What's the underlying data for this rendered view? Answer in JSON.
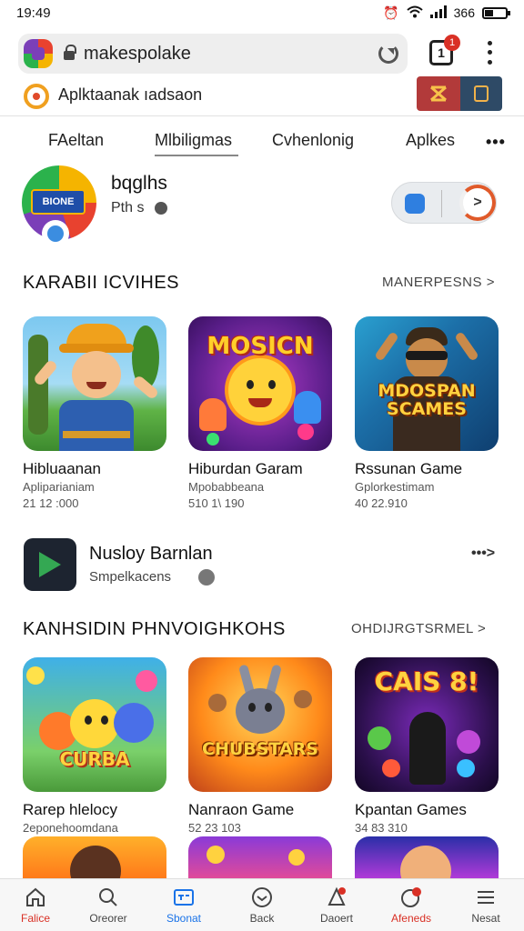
{
  "status": {
    "time": "19:49",
    "signal": "366"
  },
  "browser": {
    "url": "makespolake",
    "tab_count": "1",
    "tab_badge": "1"
  },
  "banner": {
    "text": "Aplktaanak ıadsaon"
  },
  "category_tabs": [
    {
      "label": "FAeltan"
    },
    {
      "label": "Mlbiligmas"
    },
    {
      "label": "Cvhenlonig"
    },
    {
      "label": "Aplkes"
    }
  ],
  "more_label": "•••",
  "developer": {
    "name": "bqglhs",
    "sub": "Pth s",
    "logo_text": "BIONE"
  },
  "section1": {
    "title": "KARABII ICVIHES",
    "link": "MANERPESNS >"
  },
  "apps_row1": [
    {
      "name": "Hibluaanan",
      "sub": "Apliparianiam",
      "meta": "21 12 :000"
    },
    {
      "name": "Hiburdan Garam",
      "sub": "Mpobabbeana",
      "meta": "510 1\\ 190",
      "caption": "MOSICN"
    },
    {
      "name": "Rssunan Game",
      "sub": "Gplorkestimam",
      "meta": "40 22.910",
      "caption": "MDOSPAN SCAMES"
    }
  ],
  "featured": {
    "name": "Nusloy Barnlan",
    "sub": "Smpelkacens",
    "more": "•••>"
  },
  "section2": {
    "title": "KANHSIDIN PHNVOIGHKOHS",
    "link": "OHDIJRGTSRMEL >"
  },
  "apps_row2": [
    {
      "name": "Rarep hlelocy",
      "sub": "2eponehoomdana",
      "caption": "CURBA"
    },
    {
      "name": "Nanraon Game",
      "sub": "52 23 103",
      "caption": "CHUBSTARS"
    },
    {
      "name": "Kpantan Games",
      "sub": "34 83 310",
      "caption": "CAIS 8!"
    }
  ],
  "bottom_nav": [
    {
      "label": "Falice",
      "icon": "home-icon"
    },
    {
      "label": "Oreorer",
      "icon": "search-icon"
    },
    {
      "label": "Sbonat",
      "icon": "apps-icon"
    },
    {
      "label": "Back",
      "icon": "back-icon"
    },
    {
      "label": "Daoert",
      "icon": "notification-icon"
    },
    {
      "label": "Afeneds",
      "icon": "chat-icon"
    },
    {
      "label": "Nesat",
      "icon": "menu-icon"
    }
  ],
  "colors": {
    "accent_red": "#d93025",
    "accent_blue": "#1a73e8",
    "play_green": "#34a853"
  }
}
